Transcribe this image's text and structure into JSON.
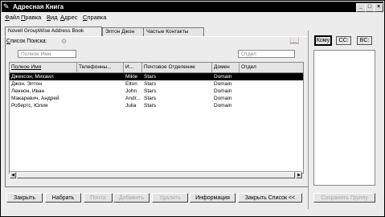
{
  "window": {
    "title": "Адресная Книга",
    "min_glyph": "_",
    "max_glyph": "□",
    "close_glyph": "×"
  },
  "menu": [
    "Файл",
    "Правка",
    "Вид",
    "Адрес",
    "Справка"
  ],
  "tabs": [
    "Novell GroupWise Address Book",
    "Элтон Джон",
    "Частые Контакты"
  ],
  "search": {
    "label": "Список Поиска:",
    "name_placeholder": "Полное Имя",
    "dept_placeholder": "Отдел"
  },
  "table": {
    "columns": [
      "Полное Имя",
      "Телефонны...",
      "И...",
      "Почтовое Отделение",
      "Домен",
      "Отдел"
    ],
    "rows": [
      {
        "name": "Джексон, Михаил",
        "phone": "",
        "id": "Mikle",
        "po": "Stars",
        "domain": "Domain",
        "dept": "",
        "selected": true
      },
      {
        "name": "Джон, Элтон",
        "phone": "",
        "id": "Elton",
        "po": "Stars",
        "domain": "Domain",
        "dept": "",
        "selected": false
      },
      {
        "name": "Леннон, Иван",
        "phone": "",
        "id": "John",
        "po": "Stars",
        "domain": "Domain",
        "dept": "",
        "selected": false
      },
      {
        "name": "Макаревич, Андрей",
        "phone": "",
        "id": "Andr...",
        "po": "Stars",
        "domain": "Domain",
        "dept": "",
        "selected": false
      },
      {
        "name": "Робертс, Юлия",
        "phone": "",
        "id": "Julia",
        "po": "Stars",
        "domain": "Domain",
        "dept": "",
        "selected": false
      }
    ]
  },
  "buttons": {
    "close": "Закрыть",
    "dial": "Набрать",
    "mail": "Почта",
    "add": "Добавить",
    "delete": "Удалить",
    "info": "Информация",
    "close_list": "Закрыть Список <<",
    "save_group": "Сохранить Группу"
  },
  "recipients": {
    "tabs": [
      "Кому",
      "CC:",
      "BC:"
    ]
  },
  "icons": {
    "app": "book-pen-icon",
    "filter": "filter-icon",
    "addressbook": "address-book-icon"
  }
}
